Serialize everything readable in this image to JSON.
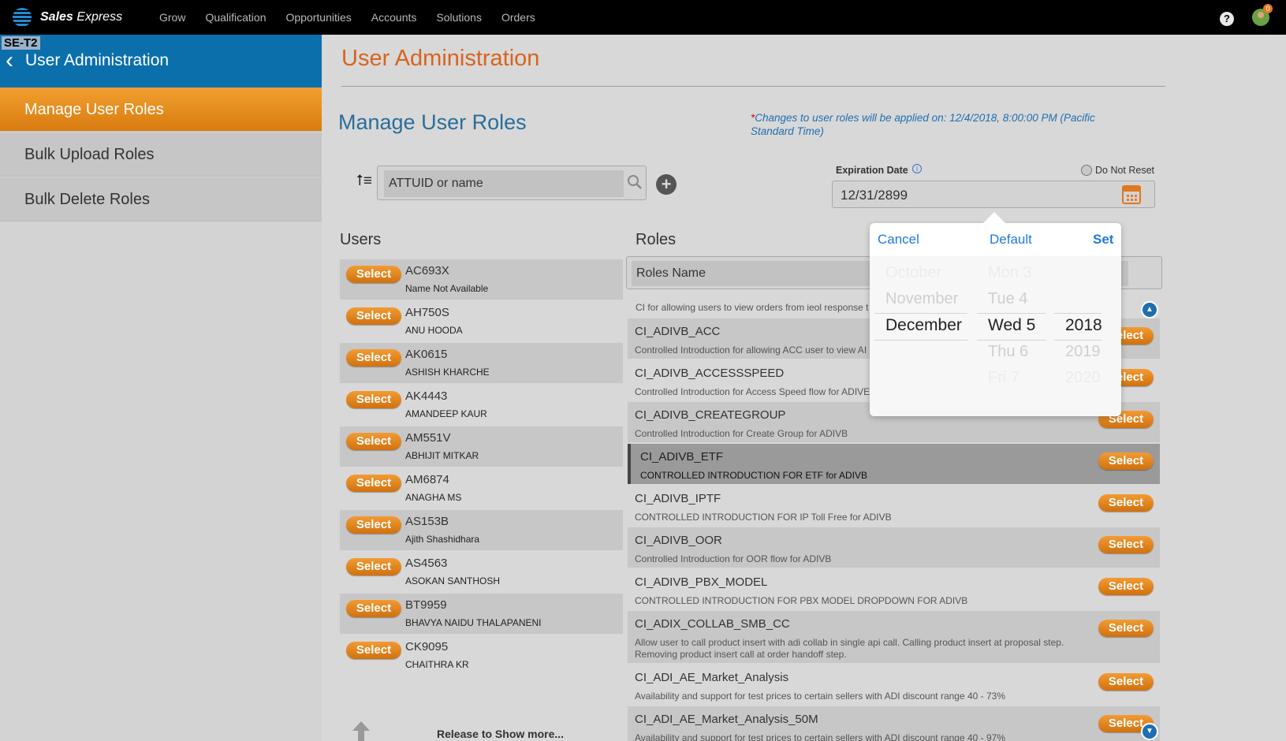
{
  "topbar": {
    "brand_bold": "Sales",
    "brand_light": "Express",
    "nav": [
      "Grow",
      "Qualification",
      "Opportunities",
      "Accounts",
      "Solutions",
      "Orders"
    ],
    "help": "?",
    "notification_count": "0"
  },
  "sidebar": {
    "env_badge": "SE-T2",
    "title": "User Administration",
    "items": [
      {
        "label": "Manage User Roles",
        "active": true
      },
      {
        "label": "Bulk Upload Roles",
        "active": false
      },
      {
        "label": "Bulk Delete Roles",
        "active": false
      }
    ]
  },
  "main": {
    "title": "User Administration",
    "subtitle": "Manage User Roles",
    "notice_star": "*",
    "notice": "Changes to user roles will be applied on: 12/4/2018, 8:00:00 PM (Pacific Standard Time)",
    "search_placeholder": "ATTUID or name",
    "expiration_label": "Expiration Date",
    "info": "i",
    "do_not_reset": "Do Not Reset",
    "expiration_value": "12/31/2899",
    "users_header": "Users",
    "roles_header": "Roles",
    "roles_placeholder": "Roles Name",
    "select_label": "Select",
    "pull_text": "Release to Show more..."
  },
  "users": [
    {
      "id": "AC693X",
      "name": "Name Not Available"
    },
    {
      "id": "AH750S",
      "name": "ANU HOODA"
    },
    {
      "id": "AK0615",
      "name": "ASHISH KHARCHE"
    },
    {
      "id": "AK4443",
      "name": "AMANDEEP KAUR"
    },
    {
      "id": "AM551V",
      "name": "ABHIJIT MITKAR"
    },
    {
      "id": "AM6874",
      "name": "ANAGHA MS"
    },
    {
      "id": "AS153B",
      "name": "Ajith Shashidhara"
    },
    {
      "id": "AS4563",
      "name": "ASOKAN SANTHOSH"
    },
    {
      "id": "BT9959",
      "name": "BHAVYA NAIDU THALAPANENI"
    },
    {
      "id": "CK9095",
      "name": "CHAITHRA KR"
    }
  ],
  "roles_first_desc": "CI for allowing users to view orders from ieol response t",
  "roles": [
    {
      "name": "CI_ADIVB_ACC",
      "desc": "Controlled Introduction for allowing ACC user to view AI"
    },
    {
      "name": "CI_ADIVB_ACCESSSPEED",
      "desc": "Controlled Introduction for Access Speed flow for ADIVE"
    },
    {
      "name": "CI_ADIVB_CREATEGROUP",
      "desc": "Controlled Introduction for Create Group for ADIVB"
    },
    {
      "name": "CI_ADIVB_ETF",
      "desc": "CONTROLLED INTRODUCTION FOR ETF for ADIVB"
    },
    {
      "name": "CI_ADIVB_IPTF",
      "desc": "CONTROLLED INTRODUCTION FOR IP Toll Free for ADIVB"
    },
    {
      "name": "CI_ADIVB_OOR",
      "desc": "Controlled Introduction for OOR flow for ADIVB"
    },
    {
      "name": "CI_ADIVB_PBX_MODEL",
      "desc": "CONTROLLED INTRODUCTION FOR PBX MODEL DROPDOWN FOR ADIVB"
    },
    {
      "name": "CI_ADIX_COLLAB_SMB_CC",
      "desc": "Allow user to call product insert with adi collab in single api call. Calling product insert at proposal step. Removing product insert call at order handoff step."
    },
    {
      "name": "CI_ADI_AE_Market_Analysis",
      "desc": "Availability and support for test prices to certain sellers with ADI discount range 40 - 73%"
    },
    {
      "name": "CI_ADI_AE_Market_Analysis_50M",
      "desc": "Availability and support for test prices to certain sellers with ADI discount range 40 - 97%"
    }
  ],
  "picker": {
    "cancel": "Cancel",
    "default": "Default",
    "set": "Set",
    "months": [
      "October",
      "November",
      "December"
    ],
    "days": [
      "Mon 3",
      "Tue 4",
      "Wed 5",
      "Thu 6",
      "Fri 7"
    ],
    "years": [
      "2018",
      "2019",
      "2020"
    ],
    "selected": {
      "month": "December",
      "day": "Wed 5",
      "year": "2018"
    }
  },
  "colors": {
    "accent_orange": "#e07820",
    "header_blue": "#0b6fab",
    "link_blue": "#1f7ae0"
  },
  "icons": [
    "att-globe-icon",
    "help-icon",
    "avatar",
    "chevron-left-icon",
    "sort-icon",
    "search-icon",
    "plus-circle-icon",
    "info-icon",
    "calendar-icon",
    "chevron-up-icon",
    "chevron-down-icon",
    "arrow-up-icon"
  ]
}
